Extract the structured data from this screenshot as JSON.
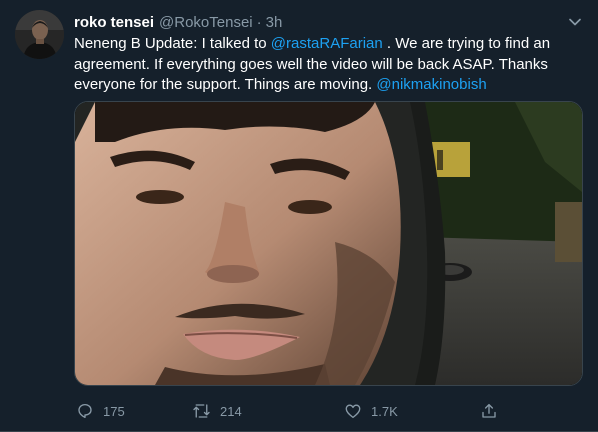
{
  "tweet": {
    "display_name": "roko tensei",
    "handle": "@RokoTensei",
    "separator": "·",
    "time": "3h",
    "text": {
      "part1": "Neneng B Update: I talked to ",
      "mention1": "@rastaRAFarian",
      "part2": " . We are trying to find an agreement. If everything goes well the video will be back ASAP. Thanks everyone for the support. Things are moving. ",
      "mention2": "@nikmakinobish"
    },
    "media_description_icon": "video-thumbnail",
    "accent_color": "#1da1f2",
    "background_color": "#15202b"
  },
  "actions": {
    "reply_count": "175",
    "retweet_count": "214",
    "like_count": "1.7K",
    "icons": [
      "reply-icon",
      "retweet-icon",
      "like-icon",
      "share-icon"
    ]
  }
}
